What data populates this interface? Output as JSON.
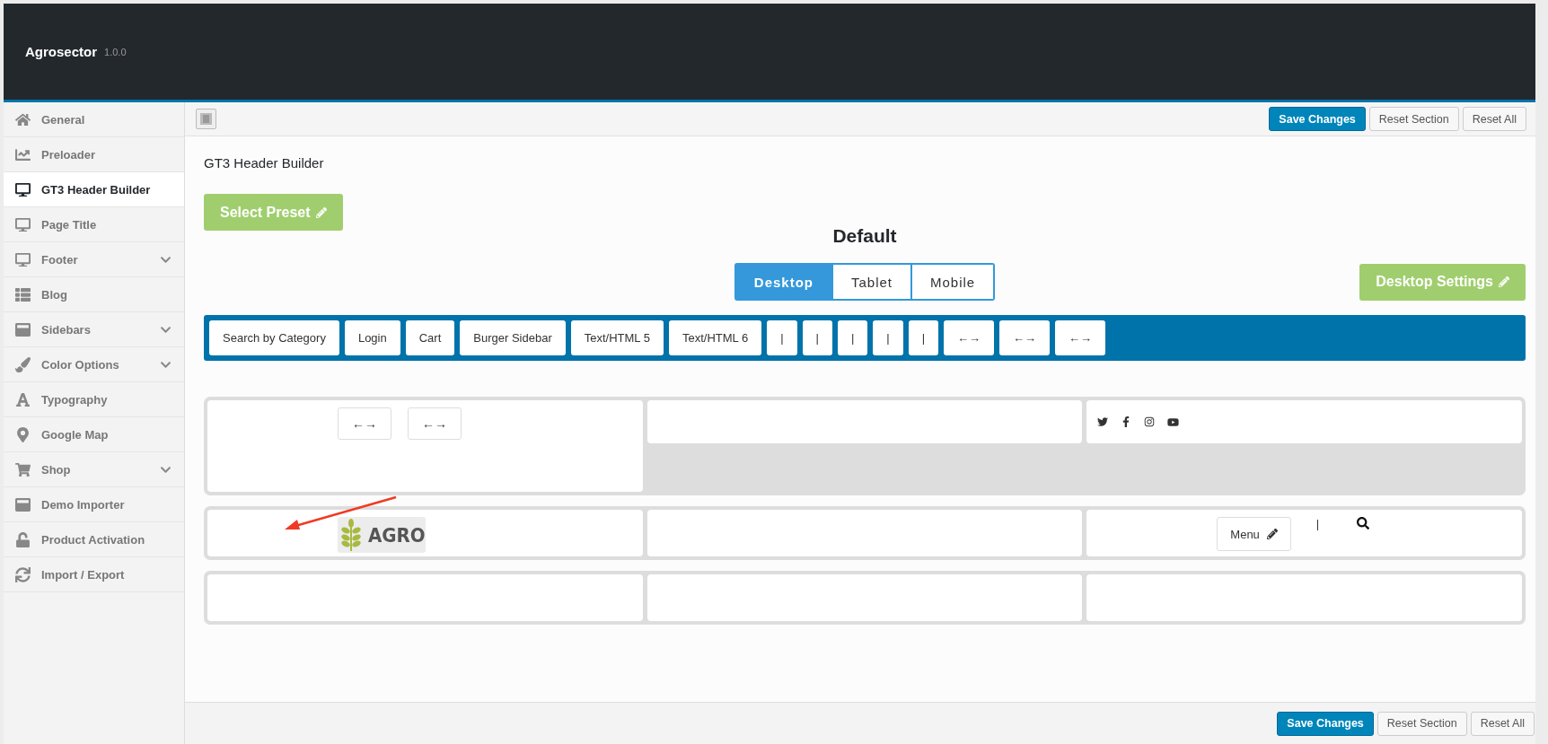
{
  "app": {
    "name": "Agrosector",
    "version": "1.0.0"
  },
  "sidebar": {
    "items": [
      {
        "label": "General",
        "selected": false,
        "expandable": false
      },
      {
        "label": "Preloader",
        "selected": false,
        "expandable": false
      },
      {
        "label": "GT3 Header Builder",
        "selected": true,
        "expandable": false
      },
      {
        "label": "Page Title",
        "selected": false,
        "expandable": false
      },
      {
        "label": "Footer",
        "selected": false,
        "expandable": true
      },
      {
        "label": "Blog",
        "selected": false,
        "expandable": false
      },
      {
        "label": "Sidebars",
        "selected": false,
        "expandable": true
      },
      {
        "label": "Color Options",
        "selected": false,
        "expandable": true
      },
      {
        "label": "Typography",
        "selected": false,
        "expandable": false
      },
      {
        "label": "Google Map",
        "selected": false,
        "expandable": false
      },
      {
        "label": "Shop",
        "selected": false,
        "expandable": true
      },
      {
        "label": "Demo Importer",
        "selected": false,
        "expandable": false
      },
      {
        "label": "Product Activation",
        "selected": false,
        "expandable": false
      },
      {
        "label": "Import / Export",
        "selected": false,
        "expandable": false
      }
    ]
  },
  "toolbar": {
    "buttons": [
      {
        "label": "Save Changes",
        "kind": "primary"
      },
      {
        "label": "Reset Section",
        "kind": "secondary"
      },
      {
        "label": "Reset All",
        "kind": "secondary"
      }
    ]
  },
  "section_title": "GT3 Header Builder",
  "preset_button": "Select Preset",
  "preset_name": "Default",
  "device_tabs": [
    {
      "label": "Desktop",
      "selected": true
    },
    {
      "label": "Tablet",
      "selected": false
    },
    {
      "label": "Mobile",
      "selected": false
    }
  ],
  "settings_button": "Desktop Settings",
  "palette": [
    "Search by Category",
    "Login",
    "Cart",
    "Burger Sidebar",
    "Text/HTML 5",
    "Text/HTML 6",
    "|",
    "|",
    "|",
    "|",
    "|",
    "←→",
    "←→",
    "←→"
  ],
  "rows": [
    {
      "kind": "tall",
      "columns": [
        {
          "items": [
            {
              "kind": "spacer",
              "text": "←→"
            },
            {
              "kind": "spacer",
              "text": "←→"
            }
          ]
        },
        {},
        {
          "items": [
            {
              "kind": "social"
            }
          ]
        }
      ]
    },
    {
      "kind": "normal",
      "columns": [
        {
          "items": [
            {
              "kind": "logo",
              "text": "AGRO"
            }
          ]
        },
        {},
        {
          "items": [
            {
              "kind": "menu",
              "text": "Menu"
            },
            {
              "kind": "divider",
              "text": "|"
            },
            {
              "kind": "search"
            }
          ]
        }
      ]
    },
    {
      "kind": "normal",
      "columns": [
        {},
        {},
        {}
      ]
    }
  ],
  "footer": {
    "buttons": [
      {
        "label": "Save Changes",
        "kind": "primary"
      },
      {
        "label": "Reset Section",
        "kind": "secondary"
      },
      {
        "label": "Reset All",
        "kind": "secondary"
      }
    ]
  }
}
